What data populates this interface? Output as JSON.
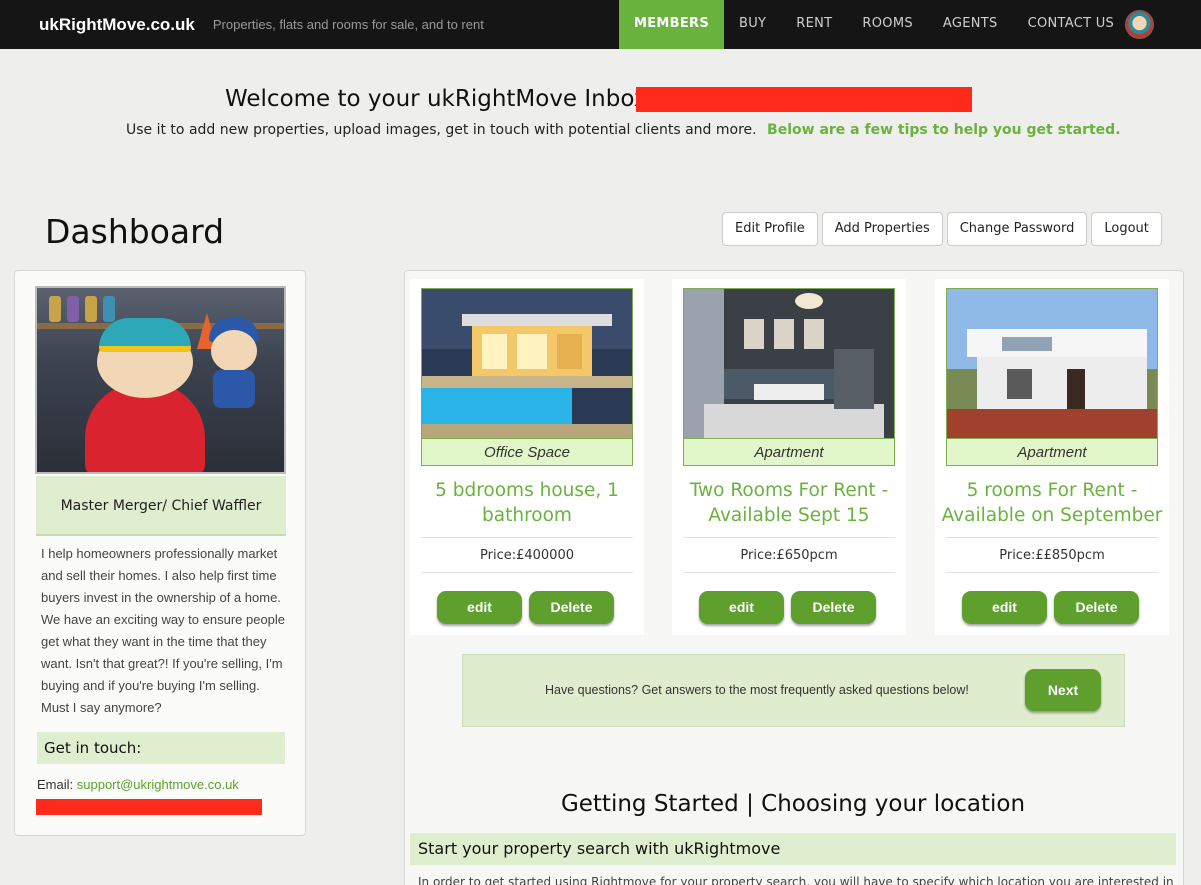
{
  "navbar": {
    "brand": "ukRightMove.co.uk",
    "tagline": "Properties, flats and rooms for sale, and to rent",
    "items": [
      {
        "label": "MEMBERS",
        "active": true
      },
      {
        "label": "BUY"
      },
      {
        "label": "RENT"
      },
      {
        "label": "ROOMS"
      },
      {
        "label": "AGENTS"
      },
      {
        "label": "CONTACT US"
      }
    ],
    "avatar_icon": "user-avatar-icon"
  },
  "welcome": {
    "title": "Welcome to your ukRightMove Inbox",
    "subtitle": "Use it to add new properties, upload images, get in touch with potential clients and more.",
    "tip": "Below are a few tips to help you get started."
  },
  "dashboard": {
    "title": "Dashboard",
    "buttons": [
      "Edit Profile",
      "Add Properties",
      "Change Password",
      "Logout"
    ]
  },
  "profile": {
    "role": "Master Merger/ Chief Waffler",
    "bio": "I help homeowners professionally market and sell their homes. I also help first time buyers invest in the ownership of a home. We have an exciting way to ensure people get what they want in the time that they want. Isn't that great?! If you're selling, I'm buying and if you're buying I'm selling. Must I say anymore?",
    "get_in_touch": "Get in touch:",
    "email_label": "Email:",
    "email": "support@ukrightmove.co.uk"
  },
  "properties": [
    {
      "type": "Office Space",
      "title": "5 bdrooms house, 1 bathroom",
      "price": "Price:£400000",
      "edit": "edit",
      "delete": "Delete"
    },
    {
      "type": "Apartment",
      "title": "Two Rooms For Rent - Available Sept 15",
      "price": "Price:£650pcm",
      "edit": "edit",
      "delete": "Delete"
    },
    {
      "type": "Apartment",
      "title": "5 rooms For Rent - Available on September",
      "price": "Price:££850pcm",
      "edit": "edit",
      "delete": "Delete"
    }
  ],
  "faq": {
    "text": "Have questions? Get answers to the most frequently asked questions below!",
    "button": "Next"
  },
  "getting_started": {
    "title": "Getting Started | Choosing your location",
    "bar": "Start your property search with ukRightmove",
    "text": "In order to get started using Rightmove for your property search, you will have to specify which location you are interested in"
  },
  "colors": {
    "accent": "#6ab23e",
    "button_green": "#5e9f2e",
    "navbar": "#151515",
    "redaction": "#ff2a1a"
  }
}
